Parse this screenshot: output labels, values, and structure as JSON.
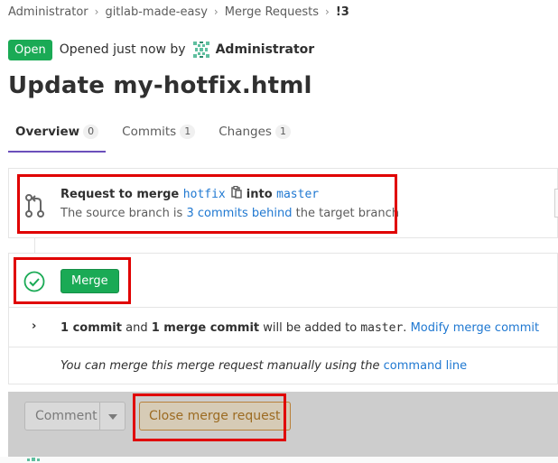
{
  "breadcrumb": {
    "items": [
      "Administrator",
      "gitlab-made-easy",
      "Merge Requests"
    ],
    "current": "!3",
    "separator": "›"
  },
  "status": {
    "badge": "Open",
    "opened_text": "Opened just now by",
    "author": "Administrator"
  },
  "title": "Update my-hotfix.html",
  "tabs": [
    {
      "label": "Overview",
      "count": "0",
      "active": true
    },
    {
      "label": "Commits",
      "count": "1",
      "active": false
    },
    {
      "label": "Changes",
      "count": "1",
      "active": false
    }
  ],
  "source_info": {
    "prefix": "Request to merge",
    "source_branch": "hotfix",
    "into": "into",
    "target_branch": "master",
    "behind_prefix": "The source branch is",
    "behind_link": "3 commits behind",
    "behind_suffix": "the target branch"
  },
  "merge_widget": {
    "merge_button": "Merge",
    "commit_count": "1 commit",
    "and": "and",
    "merge_commit": "1 merge commit",
    "added_text": "will be added to",
    "target": "master",
    "period": ".",
    "modify_link": "Modify merge commit",
    "manual_text": "You can merge this merge request manually using the",
    "command_line_link": "command line"
  },
  "comment_bar": {
    "comment_button": "Comment",
    "close_button": "Close merge request"
  },
  "colors": {
    "success": "#1aaa55",
    "link": "#1f78d1",
    "highlight": "#e00000",
    "tab_active": "#6b4fbb",
    "close_button_text": "#9c6b22"
  },
  "icons": {
    "author_avatar": "identicon-avatar",
    "source_branch": "git-merge-icon",
    "copy": "clipboard-icon",
    "ready": "check-circle-icon",
    "expand": "chevron-right-icon",
    "dropdown": "caret-down-icon"
  }
}
